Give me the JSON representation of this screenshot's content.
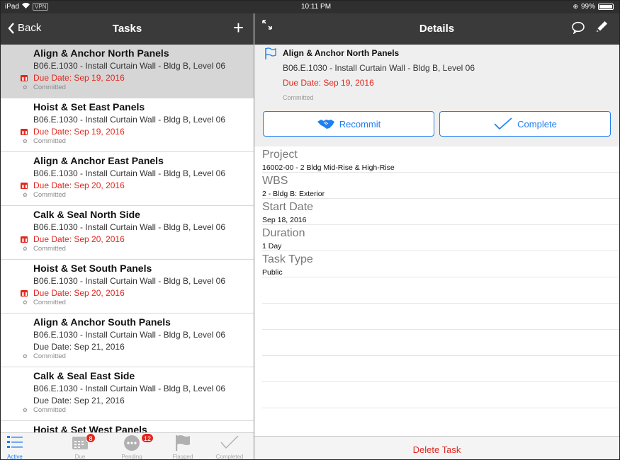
{
  "status_bar": {
    "carrier": "iPad",
    "vpn": "VPN",
    "time": "10:11 PM",
    "battery": "99%"
  },
  "left_nav": {
    "back_label": "Back",
    "title": "Tasks",
    "add_label": "+"
  },
  "right_nav": {
    "title": "Details"
  },
  "tasks": [
    {
      "title": "Align & Anchor North Panels",
      "subtitle": "B06.E.1030 - Install Curtain Wall - Bldg B, Level 06",
      "due": "Due Date: Sep 19, 2016",
      "status": "Committed",
      "overdue": true,
      "selected": true
    },
    {
      "title": "Hoist & Set East Panels",
      "subtitle": "B06.E.1030 - Install Curtain Wall - Bldg B, Level 06",
      "due": "Due Date: Sep 19, 2016",
      "status": "Committed",
      "overdue": true,
      "selected": false
    },
    {
      "title": "Align & Anchor East Panels",
      "subtitle": "B06.E.1030 - Install Curtain Wall - Bldg B, Level 06",
      "due": "Due Date: Sep 20, 2016",
      "status": "Committed",
      "overdue": true,
      "selected": false
    },
    {
      "title": "Calk & Seal North Side",
      "subtitle": "B06.E.1030 - Install Curtain Wall - Bldg B, Level 06",
      "due": "Due Date: Sep 20, 2016",
      "status": "Committed",
      "overdue": true,
      "selected": false
    },
    {
      "title": "Hoist & Set South Panels",
      "subtitle": "B06.E.1030 - Install Curtain Wall - Bldg B, Level 06",
      "due": "Due Date: Sep 20, 2016",
      "status": "Committed",
      "overdue": true,
      "selected": false
    },
    {
      "title": "Align & Anchor South Panels",
      "subtitle": "B06.E.1030 - Install Curtain Wall - Bldg B, Level 06",
      "due": "Due Date: Sep 21, 2016",
      "status": "Committed",
      "overdue": false,
      "selected": false
    },
    {
      "title": "Calk & Seal East Side",
      "subtitle": "B06.E.1030 - Install Curtain Wall - Bldg B, Level 06",
      "due": "Due Date: Sep 21, 2016",
      "status": "Committed",
      "overdue": false,
      "selected": false
    },
    {
      "title": "Hoist & Set West Panels",
      "subtitle": "",
      "due": "",
      "status": "",
      "overdue": false,
      "selected": false
    }
  ],
  "tabs": [
    {
      "label": "Active",
      "icon": "list-icon",
      "badge": "",
      "active": true
    },
    {
      "label": "Due",
      "icon": "calendar-icon",
      "badge": "8",
      "active": false
    },
    {
      "label": "Pending",
      "icon": "ellipsis-icon",
      "badge": "12",
      "active": false
    },
    {
      "label": "Flagged",
      "icon": "flag-icon",
      "badge": "",
      "active": false
    },
    {
      "label": "Completed",
      "icon": "checkmark-icon",
      "badge": "",
      "active": false
    }
  ],
  "detail": {
    "title": "Align & Anchor North Panels",
    "subtitle": "B06.E.1030 - Install Curtain Wall - Bldg B, Level 06",
    "due": "Due Date: Sep 19, 2016",
    "status": "Committed",
    "recommit_label": "Recommit",
    "complete_label": "Complete",
    "fields": [
      {
        "label": "Project",
        "value": "16002-00 - 2 Bldg Mid-Rise & High-Rise"
      },
      {
        "label": "WBS",
        "value": "2 - Bldg B: Exterior"
      },
      {
        "label": "Start Date",
        "value": "Sep 18, 2016"
      },
      {
        "label": "Duration",
        "value": "1 Day"
      },
      {
        "label": "Task Type",
        "value": "Public"
      }
    ],
    "delete_label": "Delete Task"
  },
  "colors": {
    "accent": "#1e7ef2",
    "danger": "#e0281f",
    "navbar": "#3a3a3a"
  }
}
